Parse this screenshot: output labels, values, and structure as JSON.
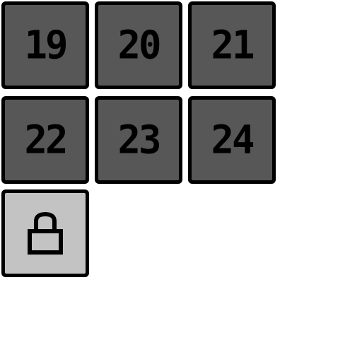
{
  "level_select": {
    "levels": [
      {
        "label": "19",
        "locked": false
      },
      {
        "label": "20",
        "locked": false
      },
      {
        "label": "21",
        "locked": false
      },
      {
        "label": "22",
        "locked": false
      },
      {
        "label": "23",
        "locked": false
      },
      {
        "label": "24",
        "locked": false
      }
    ],
    "locked_tile": {
      "icon": "lock-icon",
      "locked": true
    }
  },
  "colors": {
    "background": "#ffffff",
    "tile_border": "#000000",
    "tile_unlocked": "#575757",
    "tile_locked": "#c3c3c3",
    "text": "#000000"
  }
}
